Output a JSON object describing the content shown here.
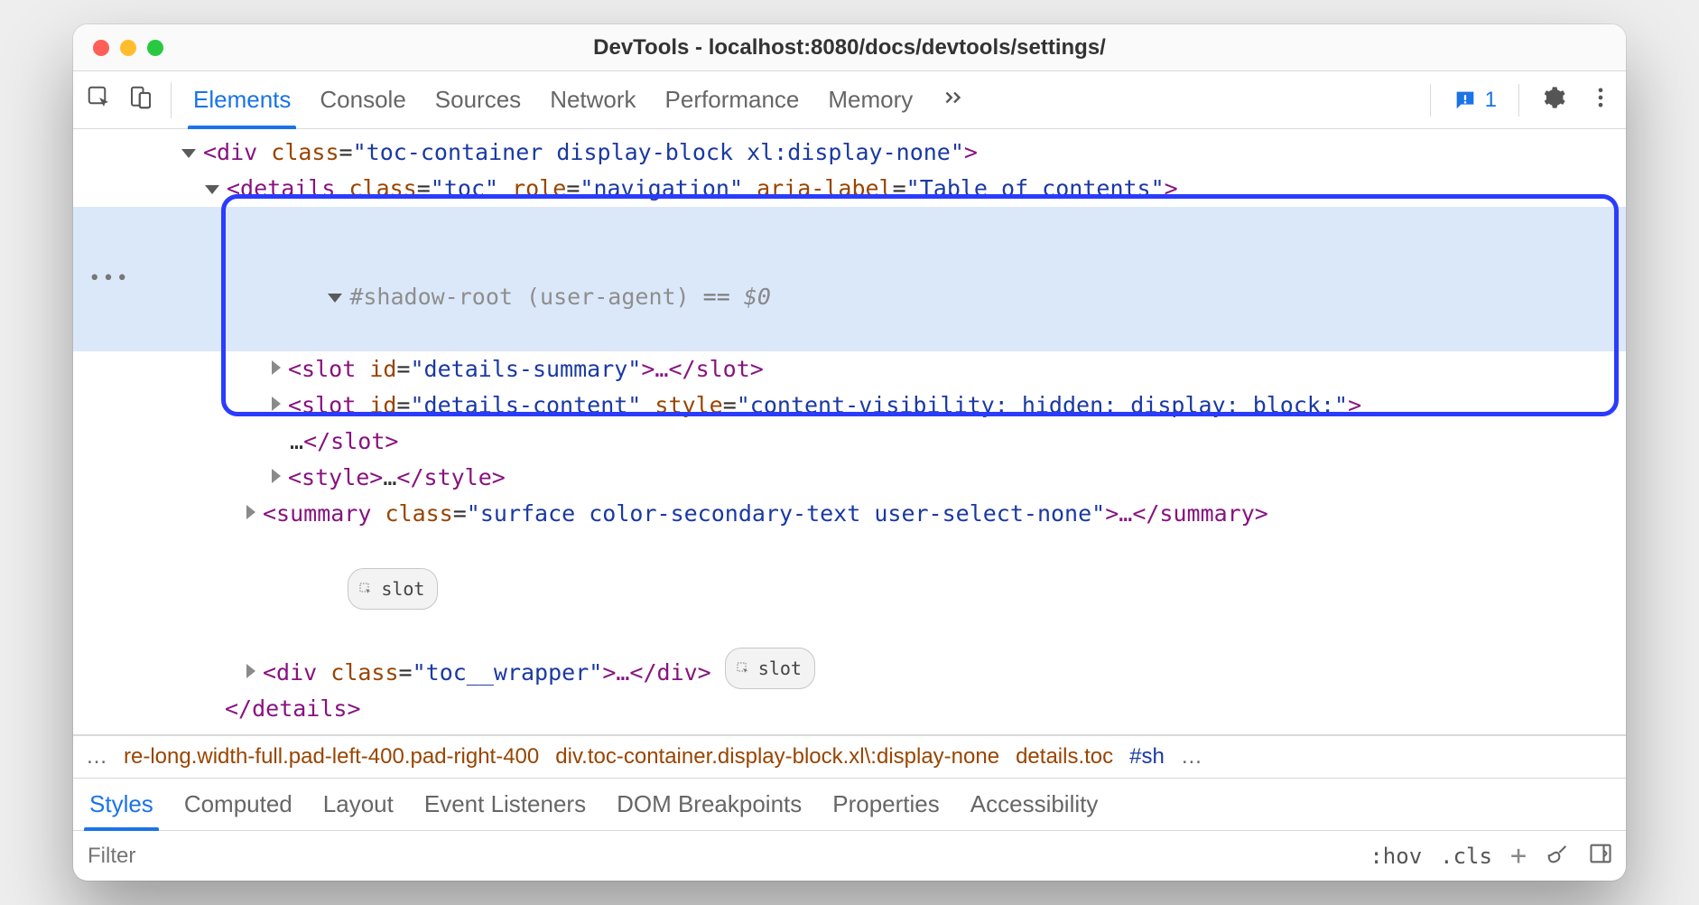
{
  "window": {
    "title": "DevTools - localhost:8080/docs/devtools/settings/"
  },
  "toolbar": {
    "tabs": [
      "Elements",
      "Console",
      "Sources",
      "Network",
      "Performance",
      "Memory"
    ],
    "issues_count": "1"
  },
  "dom": {
    "line1": {
      "tag_open": "<div ",
      "attr1": "class",
      "val1": "\"toc-container display-block xl:display-none\"",
      "close": ">"
    },
    "line2": {
      "tag_open": "<details ",
      "a1": "class",
      "v1": "\"toc\"",
      "a2": "role",
      "v2": "\"navigation\"",
      "a3": "aria-label",
      "v3": "\"Table of contents\"",
      "close": ">"
    },
    "line3": {
      "text": "#shadow-root (user-agent)",
      "eq": " == ",
      "dollar": "$0"
    },
    "line4": {
      "open": "<slot ",
      "a1": "id",
      "v1": "\"details-summary\"",
      "mid": ">…",
      "close": "</slot>"
    },
    "line5": {
      "open": "<slot ",
      "a1": "id",
      "v1": "\"details-content\"",
      "a2": "style",
      "v2": "\"content-visibility: hidden; display: block;\"",
      "end": ">"
    },
    "line5b": {
      "text": "…",
      "close": "</slot>"
    },
    "line6": {
      "open": "<style>",
      "mid": "…",
      "close": "</style>"
    },
    "line7": {
      "open": "<summary ",
      "a1": "class",
      "v1": "\"surface color-secondary-text user-select-none\"",
      "mid": ">…",
      "close": "</summary>"
    },
    "line8_badge": "slot",
    "line9": {
      "open": "<div ",
      "a1": "class",
      "v1": "\"toc__wrapper\"",
      "mid": ">…",
      "close": "</div>"
    },
    "line9_badge": "slot",
    "line10": {
      "close": "</details>"
    }
  },
  "crumbs": {
    "ell1": "…",
    "c1": "re-long.width-full.pad-left-400.pad-right-400",
    "c2": "div.toc-container.display-block.xl\\:display-none",
    "c3": "details.toc",
    "c4": "#sh",
    "ell2": "…"
  },
  "subtabs": [
    "Styles",
    "Computed",
    "Layout",
    "Event Listeners",
    "DOM Breakpoints",
    "Properties",
    "Accessibility"
  ],
  "filter": {
    "placeholder": "Filter",
    "hov": ":hov",
    "cls": ".cls"
  }
}
